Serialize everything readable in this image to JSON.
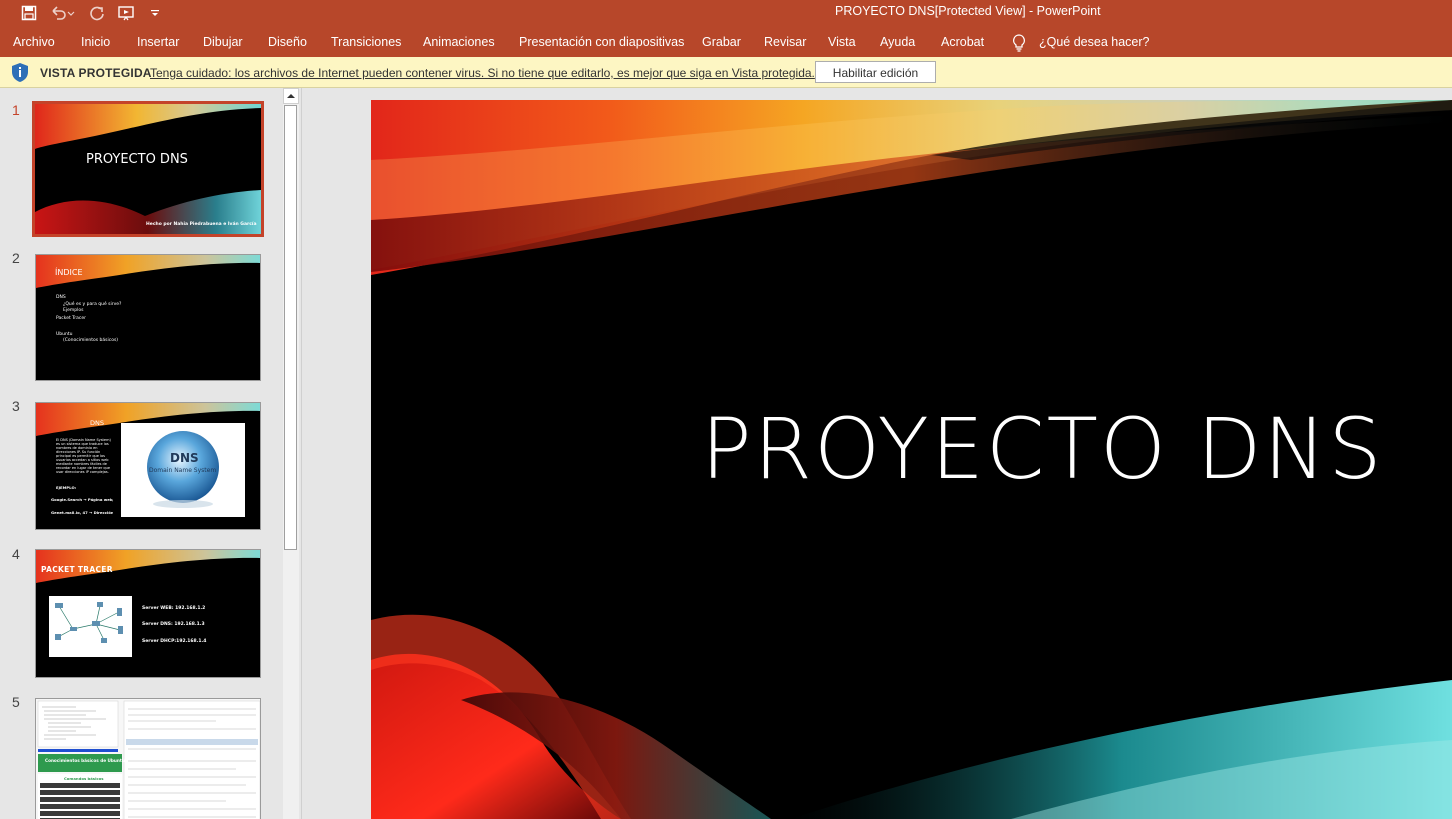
{
  "app": {
    "title": "PROYECTO DNS[Protected View]  -  PowerPoint"
  },
  "ribbon": {
    "tabs": [
      "Archivo",
      "Inicio",
      "Insertar",
      "Dibujar",
      "Diseño",
      "Transiciones",
      "Animaciones",
      "Presentación con diapositivas",
      "Grabar",
      "Revisar",
      "Vista",
      "Ayuda",
      "Acrobat"
    ],
    "tell_me": "¿Qué desea hacer?"
  },
  "protected_view": {
    "title": "VISTA PROTEGIDA",
    "message": "Tenga cuidado: los archivos de Internet pueden contener virus. Si no tiene que editarlo, es mejor que siga en Vista protegida.",
    "button": "Habilitar edición"
  },
  "thumbnails": {
    "numbers": [
      "1",
      "2",
      "3",
      "4",
      "5"
    ],
    "slide1": {
      "title": "PROYECTO DNS",
      "footer": "Hecho por Nahia Piedrabuena e Iván García"
    },
    "slide2": {
      "title": "ÍNDICE",
      "items": [
        "DNS",
        "¿Qué es y para qué sirve?",
        "Ejemplos",
        "Packet Tracer",
        "Ubuntu",
        "(Conocimientos básicos)"
      ]
    },
    "slide3": {
      "title": "DNS",
      "body": "El DNS (Domain Name System) es un sistema que traduce los nombres de dominio en direcciones IP. Su función principal es permitir que los usuarios accedan a sitios web mediante nombres fáciles de recordar en lugar de tener que usar direcciones IP complejas.",
      "example": "EJEMPLO:",
      "line1": "Google.Search → Página web/ IP",
      "line2": "Genet.mail.io, 47 → Dirección IP",
      "image_title": "DNS",
      "image_subtitle": "Domain Name System"
    },
    "slide4": {
      "title": "PACKET TRACER",
      "servers": [
        "Server WEB: 192.168.1.2",
        "Server DNS: 192.168.1.3",
        "Server DHCP:192.168.1.4"
      ]
    },
    "slide5": {
      "heading": "Conocimientos básicos de Ubuntu",
      "subheading": "Comandos básicos"
    }
  },
  "slide": {
    "title": "PROYECTO DNS"
  },
  "icons": {
    "save": "save-icon",
    "undo": "undo-icon",
    "redo": "redo-icon",
    "present": "start-from-beginning-icon",
    "customize": "customize-qat-icon",
    "lightbulb": "lightbulb-icon",
    "shield": "shield-icon"
  }
}
